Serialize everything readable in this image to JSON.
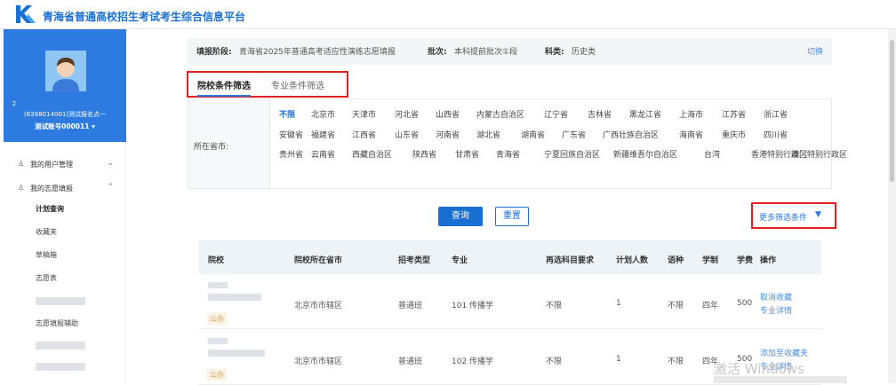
{
  "app": {
    "title": "青海省普通高校招生考试考生综合信息平台",
    "brand_color": "#1a6fd3"
  },
  "user": {
    "number": "2",
    "info": "(6398014001)测试报名点一",
    "account": "测试账号000011 ▾"
  },
  "sidebar": {
    "menu": [
      {
        "icon": "person-icon",
        "label": "我的用户管理",
        "chevron": "⌄"
      },
      {
        "icon": "person-icon",
        "label": "我的志愿填报",
        "chevron": "⌃"
      }
    ],
    "submenu": [
      "计划查询",
      "收藏夹",
      "草稿箱",
      "志愿表",
      "志愿填报辅助"
    ]
  },
  "info_bar": {
    "stage_label": "填报阶段:",
    "stage_value": "青海省2025年普通高考适应性演练志愿填报",
    "batch_label": "批次:",
    "batch_value": "本科提前批次①段",
    "subject_label": "科类:",
    "subject_value": "历史类",
    "switch": "切换"
  },
  "tabs": {
    "active": "院校条件筛选",
    "inactive": "专业条件筛选"
  },
  "filter": {
    "label": "所在省市:",
    "provinces": [
      "不限",
      "北京市",
      "天津市",
      "河北省",
      "山西省",
      "内蒙古自治区",
      "辽宁省",
      "吉林省",
      "黑龙江省",
      "上海市",
      "江苏省",
      "浙江省",
      "安徽省",
      "福建省",
      "江西省",
      "山东省",
      "河南省",
      "湖北省",
      "湖南省",
      "广东省",
      "广西壮族自治区",
      "海南省",
      "重庆市",
      "四川省",
      "贵州省",
      "云南省",
      "西藏自治区",
      "陕西省",
      "甘肃省",
      "青海省",
      "宁夏回族自治区",
      "新疆维吾尔自治区",
      "台湾",
      "香港特别行政区",
      "澳门特别行政区"
    ],
    "selected": "不限"
  },
  "buttons": {
    "query": "查询",
    "reset": "重置",
    "more_filter": "更多筛选条件",
    "more_filter_caret": "▼"
  },
  "table": {
    "headers": [
      "院校",
      "院校所在省市",
      "招考类型",
      "专业",
      "再选科目要求",
      "计划人数",
      "语种",
      "学制",
      "学费",
      "操作"
    ],
    "rows": [
      {
        "badge": "公办",
        "city": "北京市市辖区",
        "type": "普通班",
        "major": "101 传播学",
        "req": "不限",
        "plan": "1",
        "lang": "不限",
        "years": "四年",
        "fee": "500",
        "action1": "取消收藏",
        "action2": "专业详情"
      },
      {
        "badge": "公办",
        "city": "北京市市辖区",
        "type": "普通班",
        "major": "102 传播学",
        "req": "不限",
        "plan": "1",
        "lang": "不限",
        "years": "四年",
        "fee": "500",
        "action1": "添加至收藏夹",
        "action2": "专业详情"
      }
    ]
  },
  "watermark": "激活 Windows"
}
